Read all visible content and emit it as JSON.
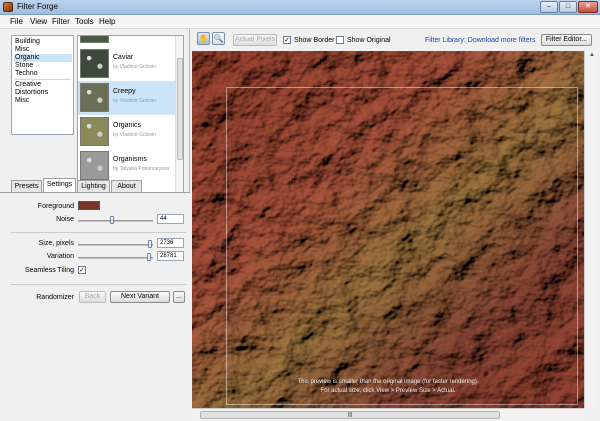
{
  "window": {
    "title": "Filter Forge",
    "min": "–",
    "max": "□",
    "close": "✕"
  },
  "menu": [
    "File",
    "View",
    "Filter",
    "Tools",
    "Help"
  ],
  "categories": [
    "Building",
    "Misc",
    "Organic",
    "Stone",
    "Techno",
    "Creative",
    "Distortions",
    "Misc"
  ],
  "selected_category": "Organic",
  "presets": [
    {
      "name": "Caviar",
      "author": "by Vladimir Golovin",
      "thumb_color": "#3c4a3a"
    },
    {
      "name": "Creepy",
      "author": "by Vladimir Golovin",
      "thumb_color": "#6b6f55"
    },
    {
      "name": "Organics",
      "author": "by Vladimir Golovin",
      "thumb_color": "#8a8a5a"
    },
    {
      "name": "Organisms",
      "author": "by Tatyana Ponomaryova",
      "thumb_color": "#9a9a9a"
    }
  ],
  "tabs": [
    "Presets",
    "Settings",
    "Lighting",
    "About"
  ],
  "active_tab": "Settings",
  "settings": {
    "foreground_label": "Foreground",
    "foreground_color": "#7c3424",
    "noise_label": "Noise",
    "noise_value": "44",
    "noise_fraction": 0.45,
    "size_label": "Size, pixels",
    "size_value": "2736",
    "size_fraction": 0.98,
    "variation_label": "Variation",
    "variation_value": "28781",
    "variation_fraction": 0.97,
    "seamless_label": "Seamless Tiling",
    "seamless_checked": true,
    "randomizer_label": "Randomizer",
    "back_label": "Back",
    "next_variant_label": "Next Variant",
    "more_label": "..."
  },
  "toolbar": {
    "actual_pixels_label": "Actual Pixels",
    "show_border_label": "Show Border",
    "show_border_checked": true,
    "show_original_label": "Show Original",
    "show_original_checked": false,
    "filter_library_link": "Filter Library: Download more filters",
    "filter_editor_label": "Filter Editor..."
  },
  "preview_notice": {
    "line1": "This preview is smaller than the original image (for faster rendering).",
    "line2": "For actual size, click View > Preview Size > Actual."
  },
  "scroll_grip": "|||"
}
